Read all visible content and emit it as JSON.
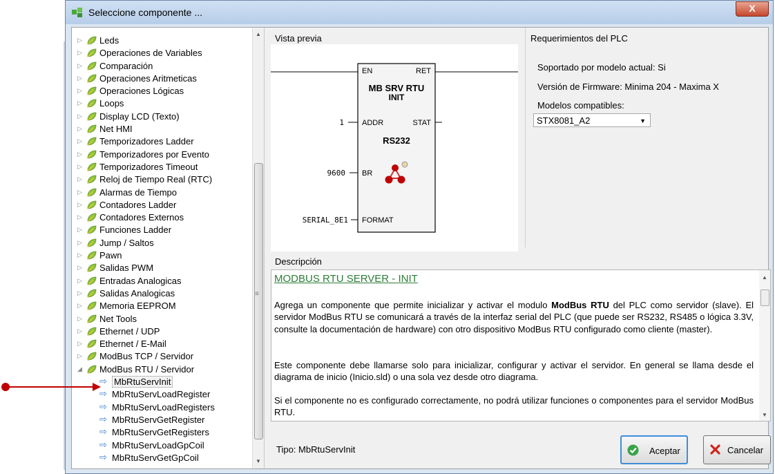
{
  "window": {
    "title": "Seleccione componente ...",
    "close_label": "X"
  },
  "tree": {
    "categories": [
      "Leds",
      "Operaciones de Variables",
      "Comparación",
      "Operaciones Aritmeticas",
      "Operaciones Lógicas",
      "Loops",
      "Display LCD (Texto)",
      "Net HMI",
      "Temporizadores Ladder",
      "Temporizadores por Evento",
      "Temporizadores Timeout",
      "Reloj de Tiempo Real (RTC)",
      "Alarmas de Tiempo",
      "Contadores Ladder",
      "Contadores Externos",
      "Funciones Ladder",
      "Jump / Saltos",
      "Pawn",
      "Salidas PWM",
      "Entradas Analogicas",
      "Salidas Analogicas",
      "Memoria EEPROM",
      "Net Tools",
      "Ethernet / UDP",
      "Ethernet / E-Mail",
      "ModBus TCP / Servidor",
      "ModBus RTU / Servidor"
    ],
    "children": [
      "MbRtuServInit",
      "MbRtuServLoadRegister",
      "MbRtuServLoadRegisters",
      "MbRtuServGetRegister",
      "MbRtuServGetRegisters",
      "MbRtuServLoadGpCoil",
      "MbRtuServGetGpCoil"
    ],
    "selected": "MbRtuServInit"
  },
  "preview": {
    "label": "Vista previa",
    "block": {
      "en": "EN",
      "ret": "RET",
      "name_line1": "MB SRV RTU",
      "name_line2": "INIT",
      "addr": "ADDR",
      "stat": "STAT",
      "iface": "RS232",
      "br": "BR",
      "format": "FORMAT",
      "addr_val": "1",
      "br_val": "9600",
      "format_val": "SERIAL_8E1"
    }
  },
  "requirements": {
    "label": "Requerimientos del PLC",
    "supported": "Soportado por modelo actual: Si",
    "firmware": "Versión de Firmware: Minima 204 - Maxima X",
    "models_label": "Modelos compatibles:",
    "model_selected": "STX8081_A2"
  },
  "description": {
    "label": "Descripción",
    "title": "MODBUS RTU SERVER - INIT",
    "p1_before": "Agrega un componente que permite inicializar y activar el modulo ",
    "p1_bold": "ModBus RTU",
    "p1_after": " del PLC como servidor (slave). El servidor ModBus RTU se comunicará a través de la interfaz serial del PLC (que puede ser RS232, RS485 o lógica 3.3V, consulte la documentación de hardware) con otro dispositivo ModBus RTU configurado como cliente (master).",
    "p2": "Este componente debe llamarse solo para inicializar, configurar y activar el servidor. En general se llama desde el diagrama de inicio (Inicio.sld) o una sola vez desde otro diagrama.",
    "p3": "Si el componente no es configurado correctamente, no podrá utilizar funciones o componentes para el servidor ModBus RTU."
  },
  "footer": {
    "tipo": "Tipo: MbRtuServInit",
    "accept": "Aceptar",
    "cancel": "Cancelar"
  },
  "colors": {
    "accent_link": "#2b7d36",
    "marker": "#c00000",
    "selection_arrow": "#3c7fd1"
  }
}
